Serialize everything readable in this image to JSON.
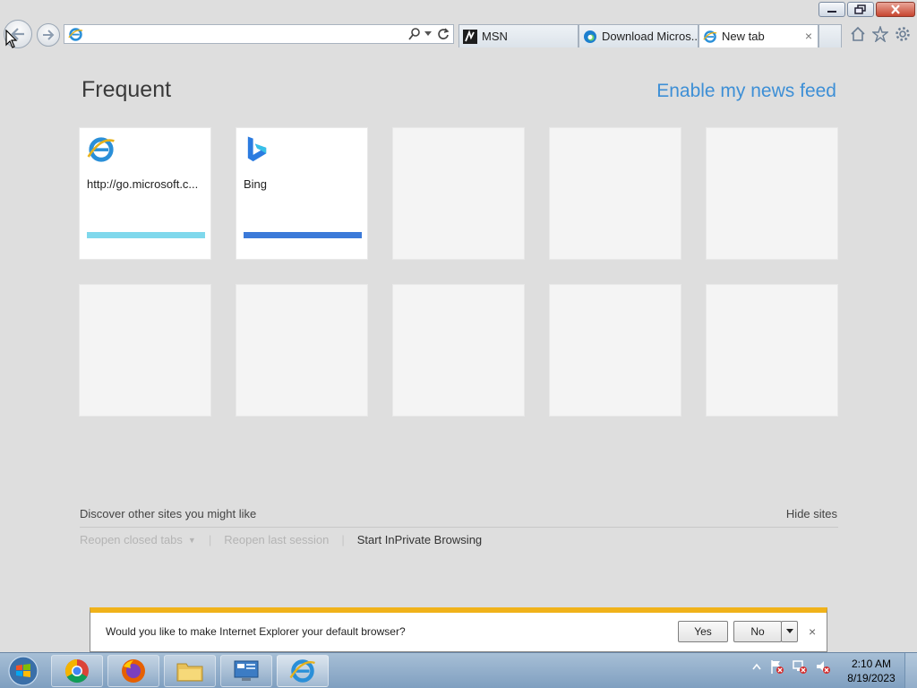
{
  "address_bar": {
    "value": "",
    "placeholder": ""
  },
  "tabs": [
    {
      "label": "MSN",
      "icon": "msn-icon"
    },
    {
      "label": "Download Micros...",
      "icon": "edge-icon"
    },
    {
      "label": "New tab",
      "icon": "ie-icon",
      "close": "×"
    }
  ],
  "page": {
    "title": "Frequent",
    "news_link": "Enable my news feed",
    "tiles": [
      {
        "name": "http://go.microsoft.c...",
        "icon": "ie-logo-icon",
        "bar_color": "#7fd8ec"
      },
      {
        "name": "Bing",
        "icon": "bing-logo-icon",
        "bar_color": "#3b7ad9"
      }
    ],
    "discover": "Discover other sites you might like",
    "hide_sites": "Hide sites",
    "links": {
      "reopen_tabs": "Reopen closed tabs",
      "reopen_session": "Reopen last session",
      "inprivate": "Start InPrivate Browsing"
    }
  },
  "notification": {
    "message": "Would you like to make Internet Explorer your default browser?",
    "yes": "Yes",
    "no": "No",
    "close": "×"
  },
  "taskbar": {
    "apps": [
      "chrome",
      "firefox",
      "file-explorer",
      "control-panel",
      "internet-explorer"
    ],
    "time": "2:10 AM",
    "date": "8/19/2023"
  },
  "colors": {
    "accent_link": "#3d8fd6",
    "notify_bar": "#f0b21a"
  }
}
